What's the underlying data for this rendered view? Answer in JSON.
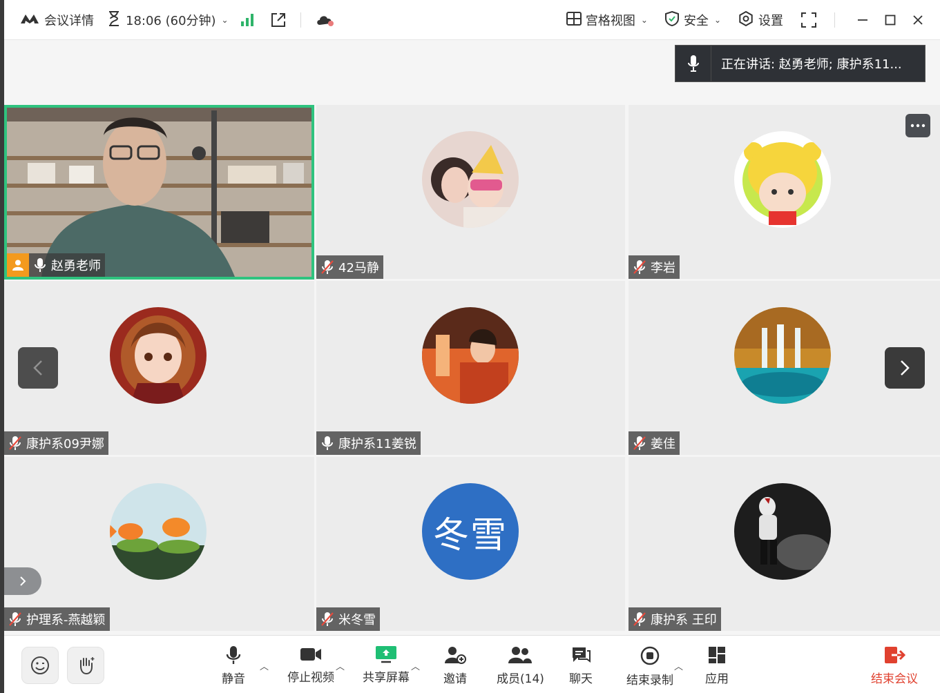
{
  "topbar": {
    "meeting_details": "会议详情",
    "time": "18:06 (60分钟)",
    "view_mode": "宫格视图",
    "security": "安全",
    "settings": "设置"
  },
  "speaking": {
    "text": "正在讲话:  赵勇老师; 康护系11..."
  },
  "participants": [
    {
      "name": "赵勇老师",
      "mic": "on"
    },
    {
      "name": "42马静",
      "mic": "muted"
    },
    {
      "name": "李岩",
      "mic": "muted"
    },
    {
      "name": "康护系09尹娜",
      "mic": "muted"
    },
    {
      "name": "康护系11姜锐",
      "mic": "on"
    },
    {
      "name": "姜佳",
      "mic": "muted"
    },
    {
      "name": "护理系-燕越颖",
      "mic": "muted"
    },
    {
      "name": "米冬雪",
      "mic": "muted",
      "avatar_text": "冬雪"
    },
    {
      "name": "康护系 王印",
      "mic": "muted"
    }
  ],
  "toolbar": {
    "mute": "静音",
    "stop_video": "停止视频",
    "share_screen": "共享屏幕",
    "invite": "邀请",
    "members": "成员(14)",
    "chat": "聊天",
    "end_recording": "结束录制",
    "apps": "应用",
    "end_meeting": "结束会议"
  },
  "colors": {
    "active_border": "#2fc37f",
    "end_meeting": "#e0412f",
    "signal": "#2fb46a",
    "avatar_blue": "#2e6fc4"
  }
}
